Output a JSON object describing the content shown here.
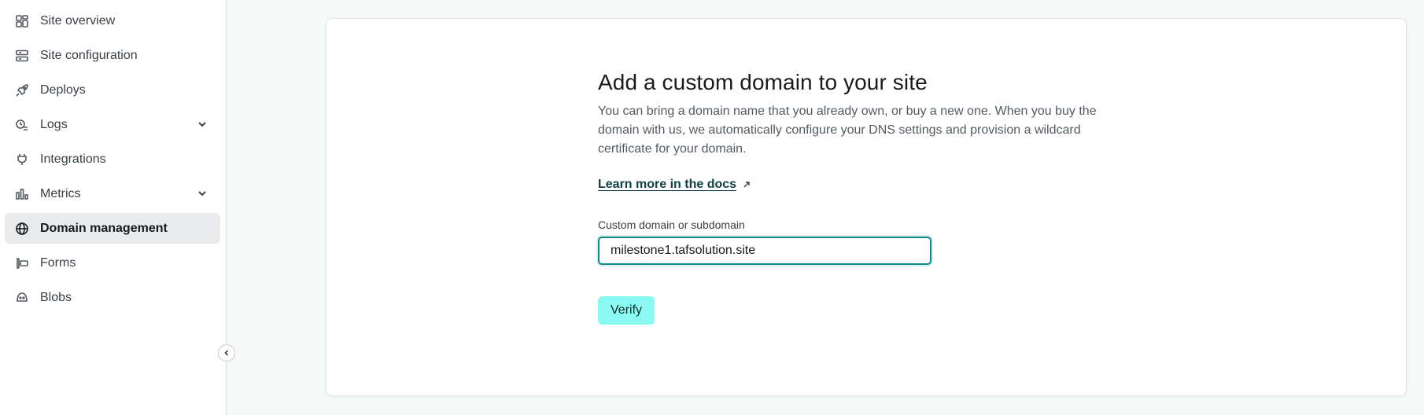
{
  "sidebar": {
    "items": [
      {
        "label": "Site overview",
        "icon": "grid-icon"
      },
      {
        "label": "Site configuration",
        "icon": "server-icon"
      },
      {
        "label": "Deploys",
        "icon": "rocket-icon"
      },
      {
        "label": "Logs",
        "icon": "logs-icon",
        "expandable": true
      },
      {
        "label": "Integrations",
        "icon": "plug-icon"
      },
      {
        "label": "Metrics",
        "icon": "bar-chart-icon",
        "expandable": true
      },
      {
        "label": "Domain management",
        "icon": "globe-icon",
        "active": true
      },
      {
        "label": "Forms",
        "icon": "form-icon"
      },
      {
        "label": "Blobs",
        "icon": "blob-icon"
      }
    ],
    "collapse_icon": "chevron-left-icon"
  },
  "main": {
    "title": "Add a custom domain to your site",
    "description": "You can bring a domain name that you already own, or buy a new one. When you buy the domain with us, we automatically configure your DNS settings and provision a wildcard certificate for your domain.",
    "docs_link": "Learn more in the docs",
    "field_label": "Custom domain or subdomain",
    "domain_value": "milestone1.tafsolution.site",
    "verify_label": "Verify"
  },
  "colors": {
    "accent": "#0f8b8d",
    "verify_bg": "#8afaf3",
    "active_item_bg": "#e9ebed"
  }
}
